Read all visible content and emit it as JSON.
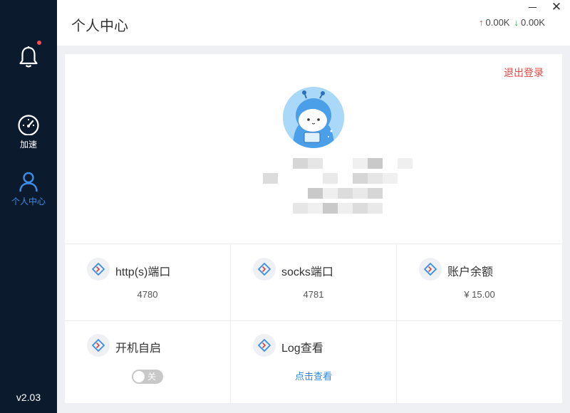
{
  "sidebar": {
    "notifications": {
      "icon": "bell-icon",
      "has_unread": true
    },
    "items": [
      {
        "icon": "speedometer-icon",
        "label": "加速"
      },
      {
        "icon": "user-icon",
        "label": "个人中心",
        "active": true
      }
    ],
    "version": "v2.03"
  },
  "header": {
    "title": "个人中心",
    "upload_speed": "0.00K",
    "download_speed": "0.00K"
  },
  "profile": {
    "logout_label": "退出登录"
  },
  "settings": {
    "http_port": {
      "label": "http(s)端口",
      "value": "4780"
    },
    "socks_port": {
      "label": "socks端口",
      "value": "4781"
    },
    "balance": {
      "label": "账户余额",
      "value": "¥ 15.00"
    },
    "autostart": {
      "label": "开机自启",
      "toggle_text": "关",
      "enabled": false
    },
    "log": {
      "label": "Log查看",
      "link": "点击查看"
    }
  },
  "colors": {
    "sidebar_bg": "#0c1a2e",
    "accent": "#3a8ee6",
    "logout": "#e04848",
    "upload_arrow": "#e04040",
    "download_arrow": "#2aa33a"
  }
}
